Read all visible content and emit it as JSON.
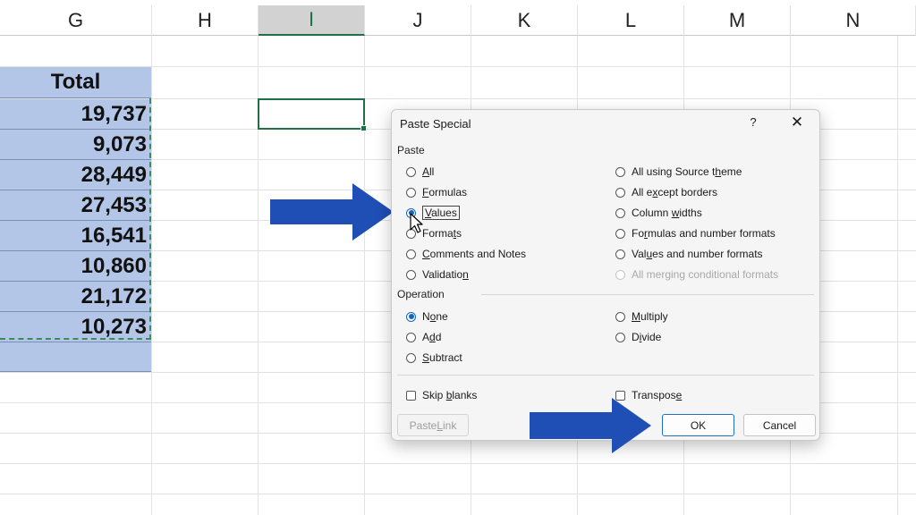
{
  "columns": [
    "G",
    "H",
    "I",
    "J",
    "K",
    "L",
    "M",
    "N"
  ],
  "selected_column": "I",
  "sheet": {
    "header": "Total",
    "values": [
      "19,737",
      "9,073",
      "28,449",
      "27,453",
      "16,541",
      "10,860",
      "21,172",
      "10,273"
    ]
  },
  "dialog": {
    "title": "Paste Special",
    "help": "?",
    "close": "✕",
    "paste_label": "Paste",
    "paste_left": [
      {
        "pre": "",
        "key": "A",
        "post": "ll",
        "checked": false
      },
      {
        "pre": "",
        "key": "F",
        "post": "ormulas",
        "checked": false
      },
      {
        "pre": "",
        "key": "V",
        "post": "alues",
        "checked": true
      },
      {
        "pre": "Forma",
        "key": "t",
        "post": "s",
        "checked": false
      },
      {
        "pre": "",
        "key": "C",
        "post": "omments and Notes",
        "checked": false
      },
      {
        "pre": "Validatio",
        "key": "n",
        "post": "",
        "checked": false
      }
    ],
    "paste_right": [
      {
        "pre": "All using Source t",
        "key": "h",
        "post": "eme",
        "checked": false,
        "disabled": false
      },
      {
        "pre": "All e",
        "key": "x",
        "post": "cept borders",
        "checked": false,
        "disabled": false
      },
      {
        "pre": "Column ",
        "key": "w",
        "post": "idths",
        "checked": false,
        "disabled": false
      },
      {
        "pre": "Fo",
        "key": "r",
        "post": "mulas and number formats",
        "checked": false,
        "disabled": false
      },
      {
        "pre": "Val",
        "key": "u",
        "post": "es and number formats",
        "checked": false,
        "disabled": false
      },
      {
        "pre": "All merging conditional formats",
        "key": "",
        "post": "",
        "checked": false,
        "disabled": true
      }
    ],
    "operation_label": "Operation",
    "op_left": [
      {
        "pre": "N",
        "key": "o",
        "post": "ne",
        "checked": true
      },
      {
        "pre": "A",
        "key": "d",
        "post": "d",
        "checked": false
      },
      {
        "pre": "",
        "key": "S",
        "post": "ubtract",
        "checked": false
      }
    ],
    "op_right": [
      {
        "pre": "",
        "key": "M",
        "post": "ultiply",
        "checked": false
      },
      {
        "pre": "D",
        "key": "i",
        "post": "vide",
        "checked": false
      }
    ],
    "skip_blanks": {
      "pre": "Skip ",
      "key": "b",
      "post": "lanks",
      "checked": false
    },
    "transpose": {
      "pre": "Transpos",
      "key": "e",
      "post": "",
      "checked": false
    },
    "paste_link": {
      "pre": "Paste ",
      "key": "L",
      "post": "ink",
      "disabled": true
    },
    "ok": "OK",
    "cancel": "Cancel"
  },
  "colors": {
    "arrow": "#1f4fb5",
    "selection": "#b4c6e7",
    "excel_green": "#1e7145",
    "radio_checked": "#1565c0"
  }
}
